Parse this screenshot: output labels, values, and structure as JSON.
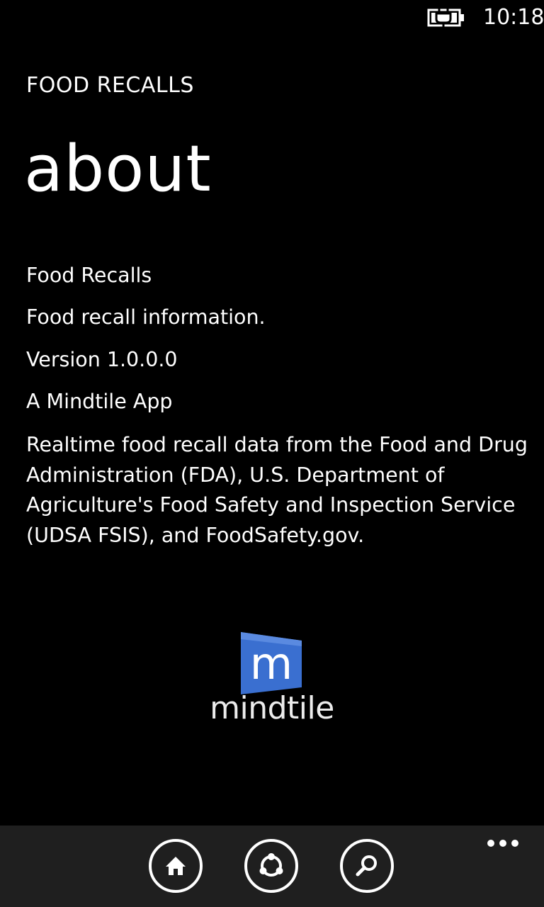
{
  "status_bar": {
    "time": "10:18",
    "battery_icon": "battery-charging-icon"
  },
  "header": {
    "app_title": "FOOD RECALLS",
    "page_title": "about"
  },
  "about": {
    "app_name": "Food Recalls",
    "tagline": "Food recall information.",
    "version": "Version 1.0.0.0",
    "publisher": "A Mindtile App",
    "description": "Realtime food recall data from the Food and Drug Administration (FDA), U.S. Department of Agriculture's Food Safety and Inspection Service (UDSA FSIS), and FoodSafety.gov."
  },
  "logo": {
    "letter": "m",
    "wordmark": "mindtile",
    "accent_color": "#3a6fd0"
  },
  "app_bar": {
    "buttons": [
      {
        "icon": "home-icon"
      },
      {
        "icon": "share-icon"
      },
      {
        "icon": "search-icon"
      }
    ],
    "more_icon": "more-ellipsis-icon",
    "background_color": "#1f1f1f"
  }
}
